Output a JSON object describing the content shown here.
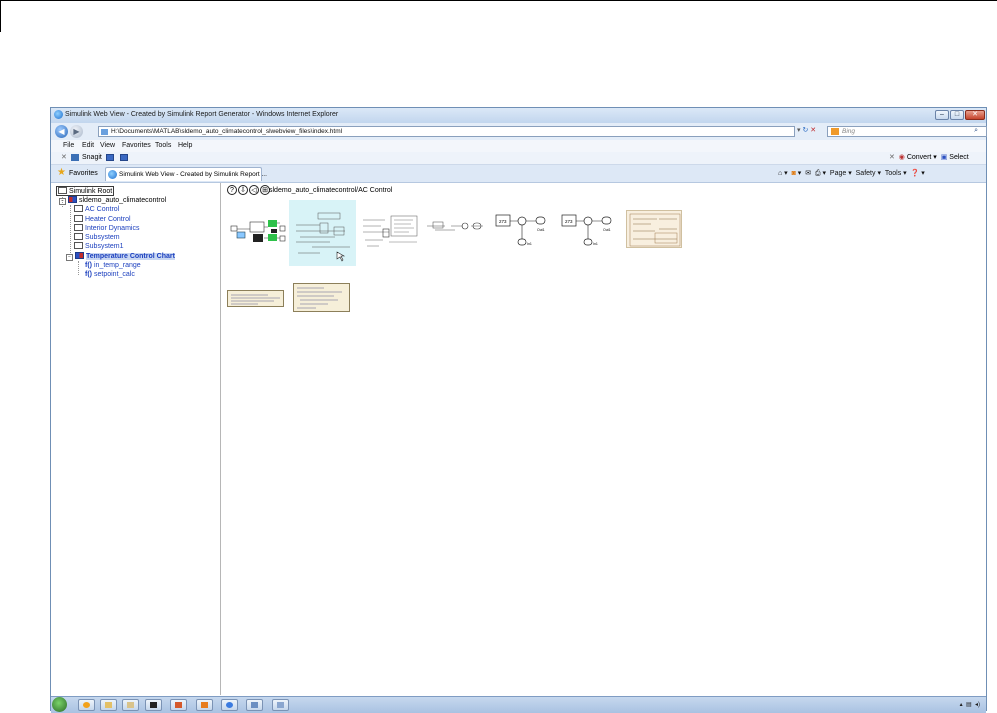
{
  "window": {
    "title": "Simulink Web View - Created by Simulink Report Generator - Windows Internet Explorer",
    "caption_buttons": {
      "minimize": "–",
      "maximize": "□",
      "close": "✕"
    }
  },
  "address_bar": {
    "url": "H:\\Documents\\MATLAB\\sldemo_auto_climatecontrol_slwebview_files\\index.html",
    "search_placeholder": "Bing"
  },
  "menu": [
    "File",
    "Edit",
    "View",
    "Favorites",
    "Tools",
    "Help"
  ],
  "toolbar": {
    "snagit_label": "Snagit",
    "convert_label": "Convert",
    "select_label": "Select"
  },
  "favorites_bar": {
    "favorites_label": "Favorites",
    "tab_label": "Simulink Web View - Created by Simulink Report ..."
  },
  "command_bar": {
    "page_label": "Page",
    "safety_label": "Safety",
    "tools_label": "Tools"
  },
  "tree": {
    "root": "Simulink Root",
    "model": "sldemo_auto_climatecontrol",
    "children": [
      "AC Control",
      "Heater Control",
      "Interior Dynamics",
      "Subsystem",
      "Subsystem1",
      "Temperature Control Chart"
    ],
    "chart_children": [
      "in_temp_range",
      "setpoint_calc"
    ]
  },
  "breadcrumb": {
    "buttons": [
      "?",
      "⇩",
      "◁",
      "⊞"
    ],
    "path": "sldemo_auto_climatecontrol/AC Control"
  },
  "thumb_labels": {
    "constant_a": "273",
    "constant_b": "273",
    "out_a": "Out1",
    "out_b": "Out1",
    "in_a": "In1",
    "in_b": "In1"
  },
  "colors": {
    "accent": "#1b3fbe",
    "selection": "#c9d7f2",
    "highlight_thumb": "#d8f3f7"
  }
}
